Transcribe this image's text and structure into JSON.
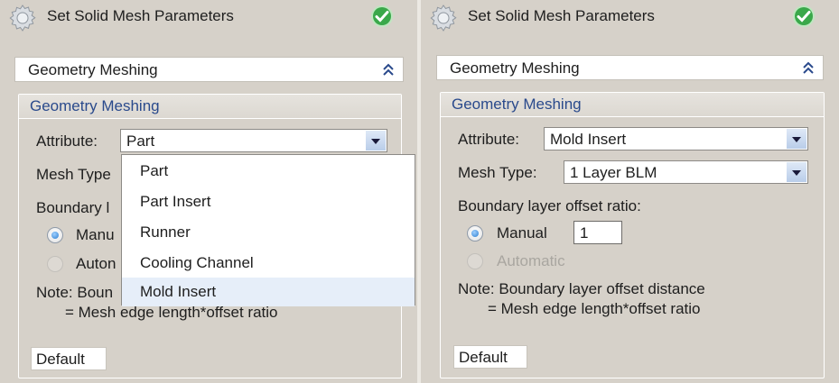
{
  "colors": {
    "panel_bg": "#d6d1c9",
    "group_title": "#2a4a8c",
    "ok_green": "#3aa84a",
    "dropdown_hover": "#e6eef9"
  },
  "left": {
    "title": "Set Solid Mesh Parameters",
    "icons": {
      "settings": "gear-icon",
      "ok": "green-check-icon",
      "collapse": "double-chevron-up-icon"
    },
    "section_header": "Geometry Meshing",
    "group_title": "Geometry Meshing",
    "attribute_label": "Attribute:",
    "attribute_value": "Part",
    "mesh_type_label": "Mesh Type",
    "boundary_label": "Boundary l",
    "manual_label": "Manu",
    "automatic_label": "Auton",
    "note_line1": "Note: Boun",
    "note_line2": "= Mesh edge length*offset ratio",
    "default_button": "Default",
    "dropdown_options": [
      "Part",
      "Part Insert",
      "Runner",
      "Cooling Channel",
      "Mold Insert"
    ],
    "dropdown_hovered": "Mold Insert"
  },
  "right": {
    "title": "Set Solid Mesh Parameters",
    "section_header": "Geometry Meshing",
    "group_title": "Geometry Meshing",
    "attribute_label": "Attribute:",
    "attribute_value": "Mold Insert",
    "mesh_type_label": "Mesh Type:",
    "mesh_type_value": "1 Layer BLM",
    "boundary_label": "Boundary layer offset ratio:",
    "manual_label": "Manual",
    "manual_value": "1",
    "automatic_label": "Automatic",
    "note_line1": "Note: Boundary layer offset distance",
    "note_line2": "= Mesh edge length*offset ratio",
    "default_button": "Default"
  }
}
